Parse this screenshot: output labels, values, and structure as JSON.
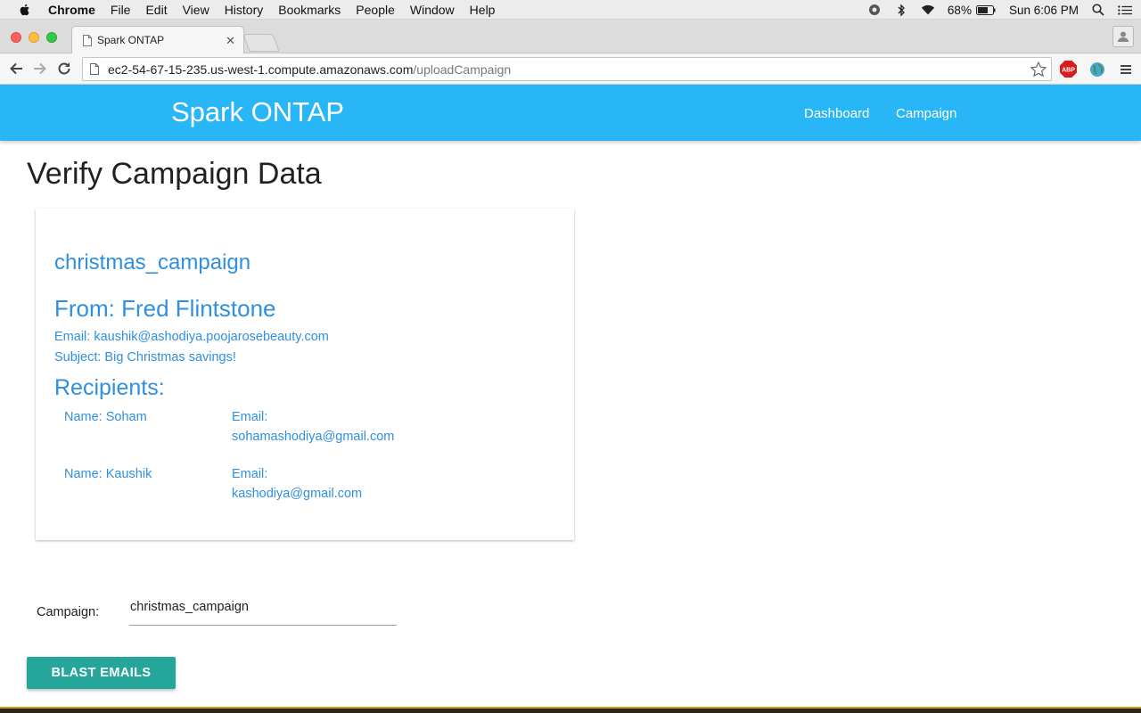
{
  "menubar": {
    "items": [
      "Chrome",
      "File",
      "Edit",
      "View",
      "History",
      "Bookmarks",
      "People",
      "Window",
      "Help"
    ],
    "battery": "68%",
    "clock": "Sun 6:06 PM"
  },
  "browser": {
    "tab_title": "Spark ONTAP",
    "url_host": "ec2-54-67-15-235.us-west-1.compute.amazonaws.com",
    "url_path": "/uploadCampaign",
    "abp_label": "ABP"
  },
  "app": {
    "brand": "Spark ONTAP",
    "nav": [
      "Dashboard",
      "Campaign"
    ],
    "accent": "#29b6f6"
  },
  "page": {
    "title": "Verify Campaign Data"
  },
  "campaign": {
    "name": "christmas_campaign",
    "from": "From: Fred Flintstone",
    "email": "Email: kaushik@ashodiya.poojarosebeauty.com",
    "subject": "Subject: Big Christmas savings!",
    "recipients_heading": "Recipients:",
    "recipients": [
      {
        "name": "Name: Soham",
        "email_label": "Email:",
        "email": "sohamashodiya@gmail.com"
      },
      {
        "name": "Name: Kaushik",
        "email_label": "Email:",
        "email": "kashodiya@gmail.com"
      }
    ]
  },
  "form": {
    "label": "Campaign:",
    "value": "christmas_campaign",
    "button_label": "BLAST EMAILS",
    "button_color": "#26a69a"
  }
}
